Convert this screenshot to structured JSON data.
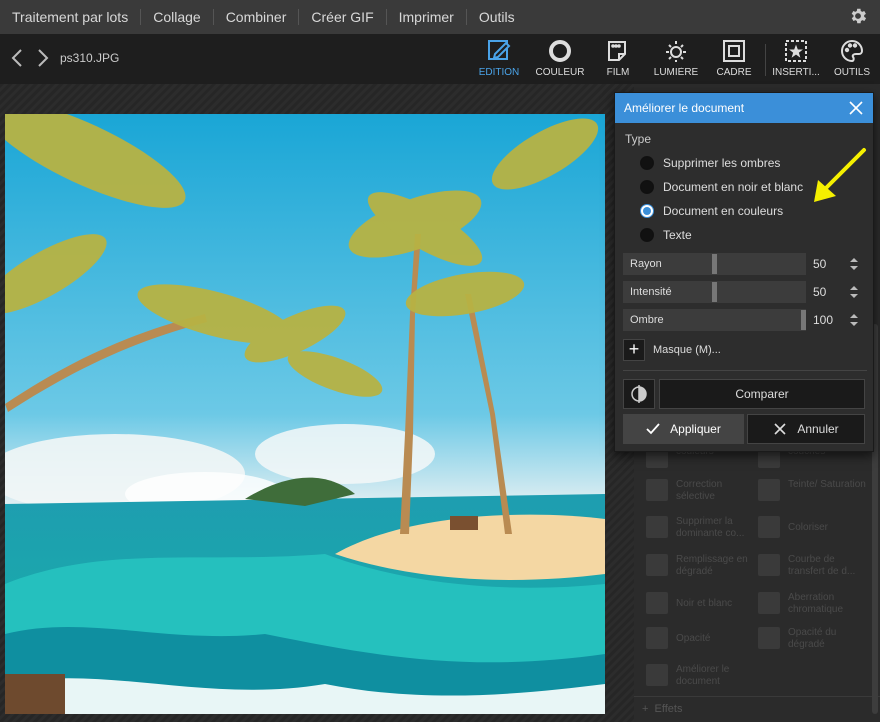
{
  "top_menu": {
    "items": [
      "Traitement par lots",
      "Collage",
      "Combiner",
      "Créer GIF",
      "Imprimer",
      "Outils"
    ]
  },
  "toolbar": {
    "filename": "ps310.JPG",
    "tools": [
      {
        "label": "EDITION",
        "icon": "edit-icon",
        "active": true
      },
      {
        "label": "COULEUR",
        "icon": "color-ring-icon",
        "active": false
      },
      {
        "label": "FILM",
        "icon": "film-icon",
        "active": false
      },
      {
        "label": "LUMIÈRE",
        "icon": "sun-icon",
        "active": false
      },
      {
        "label": "CADRE",
        "icon": "frame-icon",
        "active": false
      },
      {
        "label": "INSERTI...",
        "icon": "insert-icon",
        "active": false
      },
      {
        "label": "OUTILS",
        "icon": "palette-icon",
        "active": false
      }
    ],
    "accent_color": "#4aa3e8"
  },
  "right_panel": {
    "items": [
      {
        "label": "couleurs",
        "icon": "color-balance-icon"
      },
      {
        "label": "couches",
        "icon": "layers-icon"
      },
      {
        "label": "Correction sélective",
        "icon": "selective-correction-icon"
      },
      {
        "label": "Teinte/ Saturation",
        "icon": "hue-saturation-icon"
      },
      {
        "label": "Supprimer la dominante co...",
        "icon": "remove-cast-icon"
      },
      {
        "label": "Coloriser",
        "icon": "colorize-icon"
      },
      {
        "label": "Remplissage en dégradé",
        "icon": "gradient-fill-icon"
      },
      {
        "label": "Courbe de transfert de d...",
        "icon": "transfer-curve-icon"
      },
      {
        "label": "Noir et blanc",
        "icon": "black-white-icon"
      },
      {
        "label": "Aberration chromatique",
        "icon": "chromatic-aberration-icon"
      },
      {
        "label": "Opacité",
        "icon": "opacity-icon"
      },
      {
        "label": "Opacité du dégradé",
        "icon": "gradient-opacity-icon"
      },
      {
        "label": "Améliorer le document",
        "icon": "enhance-document-icon"
      }
    ],
    "bottom_label": "Effets"
  },
  "dialog": {
    "title": "Améliorer le document",
    "type_label": "Type",
    "options": [
      {
        "label": "Supprimer les ombres",
        "selected": false
      },
      {
        "label": "Document en noir et blanc",
        "selected": false
      },
      {
        "label": "Document en couleurs",
        "selected": true
      },
      {
        "label": "Texte",
        "selected": false
      }
    ],
    "sliders": [
      {
        "label": "Rayon",
        "value": "50",
        "level": 0.5
      },
      {
        "label": "Intensité",
        "value": "50",
        "level": 0.5
      },
      {
        "label": "Ombre",
        "value": "100",
        "level": 1.0
      }
    ],
    "mask_label": "Masque (M)...",
    "compare_label": "Comparer",
    "apply_label": "Appliquer",
    "cancel_label": "Annuler",
    "title_bar_color": "#3b8fd9"
  },
  "annotation": {
    "color": "#f5f000"
  }
}
